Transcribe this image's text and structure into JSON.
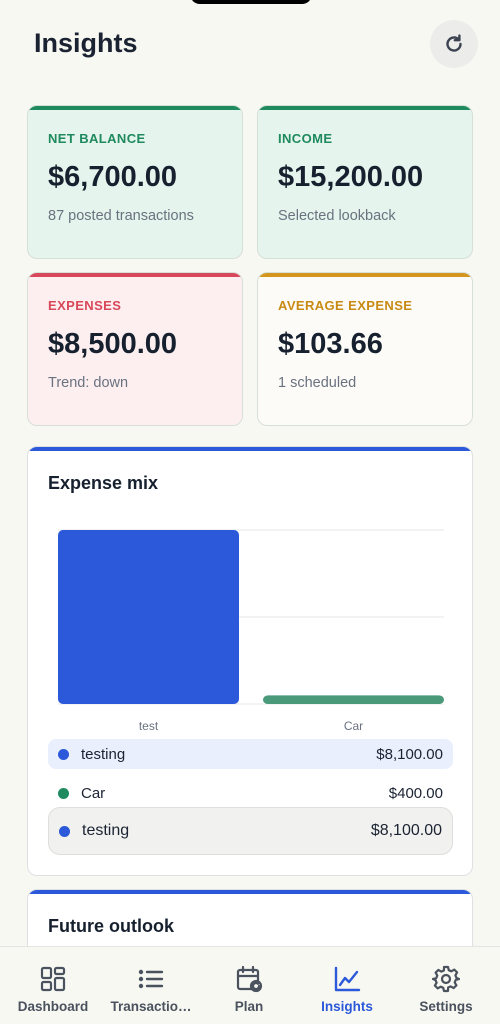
{
  "header": {
    "title": "Insights"
  },
  "stats": [
    {
      "label": "NET BALANCE",
      "value": "$6,700.00",
      "sub": "87 posted transactions",
      "accent": "#1e8a5e",
      "bg": "#e5f4ec",
      "labelColor": "#1e8a5e"
    },
    {
      "label": "INCOME",
      "value": "$15,200.00",
      "sub": "Selected lookback",
      "accent": "#1e8a5e",
      "bg": "#e5f4ec",
      "labelColor": "#1e8a5e"
    },
    {
      "label": "EXPENSES",
      "value": "$8,500.00",
      "sub": "Trend: down",
      "accent": "#d9485a",
      "bg": "#fdeff0",
      "labelColor": "#d9485a"
    },
    {
      "label": "AVERAGE EXPENSE",
      "value": "$103.66",
      "sub": "1 scheduled",
      "accent": "#d4961e",
      "bg": "#fcfbf8",
      "labelColor": "#c98a14"
    }
  ],
  "expense_mix": {
    "title": "Expense mix",
    "legend": [
      {
        "name": "testing",
        "amount": "$8,100.00",
        "color": "#2b59d9",
        "state": "highlight"
      },
      {
        "name": "Car",
        "amount": "$400.00",
        "color": "#1e8a5e",
        "state": "normal"
      },
      {
        "name": "testing",
        "amount": "$8,100.00",
        "color": "#2b59d9",
        "state": "selected"
      }
    ]
  },
  "chart_data": {
    "type": "bar",
    "categories": [
      "test",
      "Car"
    ],
    "values": [
      8100,
      400
    ],
    "colors": [
      "#2b59d9",
      "#4a9a7a"
    ],
    "ylim": [
      0,
      8100
    ],
    "grid": true,
    "title": "",
    "xlabel": "",
    "ylabel": ""
  },
  "future_outlook": {
    "title": "Future outlook"
  },
  "nav": [
    {
      "label": "Dashboard",
      "icon": "dashboard-icon",
      "active": false
    },
    {
      "label": "Transactio…",
      "icon": "list-icon",
      "active": false
    },
    {
      "label": "Plan",
      "icon": "calendar-refresh-icon",
      "active": false
    },
    {
      "label": "Insights",
      "icon": "line-chart-icon",
      "active": true
    },
    {
      "label": "Settings",
      "icon": "gear-icon",
      "active": false
    }
  ]
}
